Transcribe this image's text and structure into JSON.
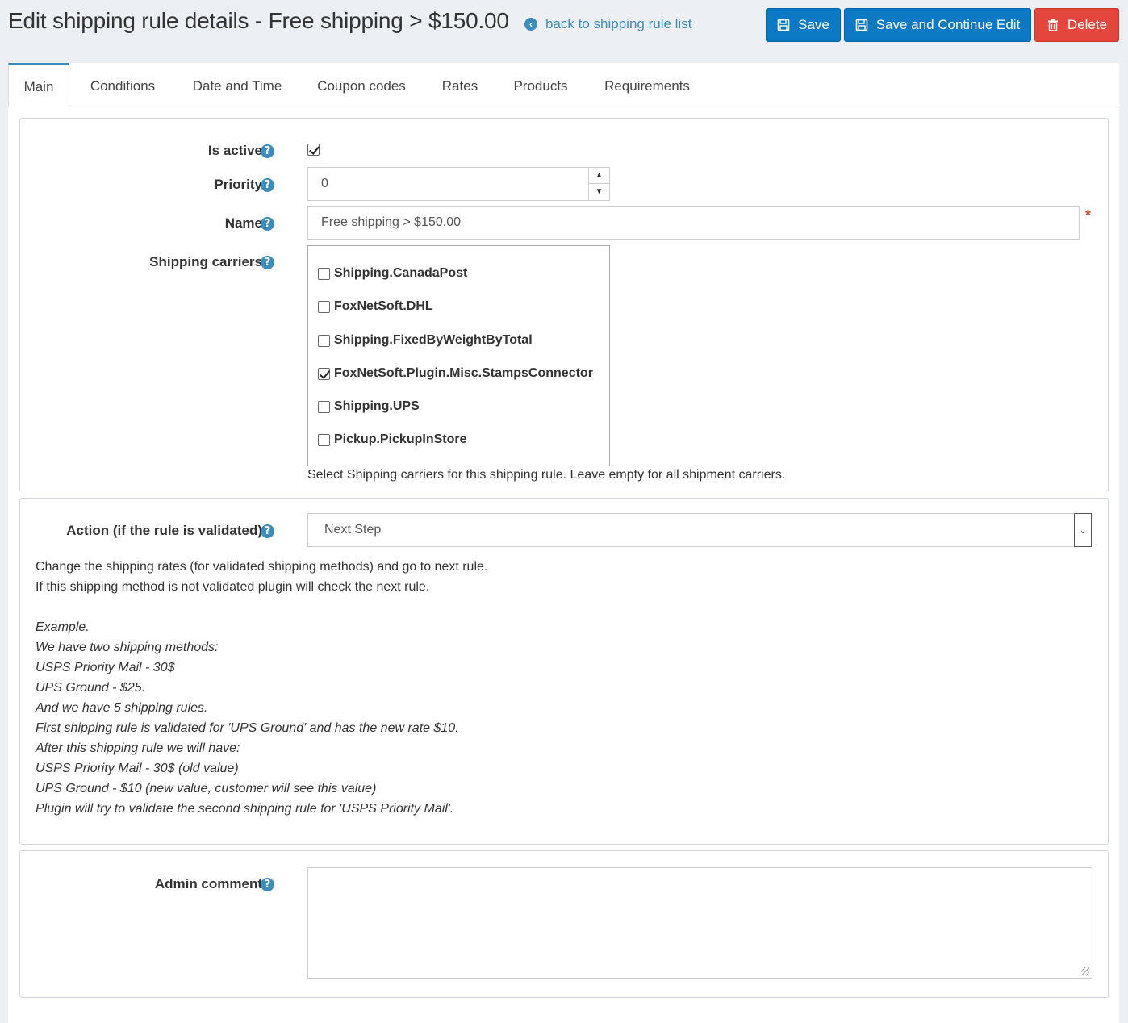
{
  "header": {
    "title": "Edit shipping rule details - Free shipping > $150.00",
    "back_link": "back to shipping rule list",
    "save_label": "Save",
    "save_continue_label": "Save and Continue Edit",
    "delete_label": "Delete"
  },
  "tabs": [
    {
      "label": "Main",
      "active": true
    },
    {
      "label": "Conditions",
      "active": false
    },
    {
      "label": "Date and Time",
      "active": false
    },
    {
      "label": "Coupon codes",
      "active": false
    },
    {
      "label": "Rates",
      "active": false
    },
    {
      "label": "Products",
      "active": false
    },
    {
      "label": "Requirements",
      "active": false
    }
  ],
  "main": {
    "is_active_label": "Is active",
    "is_active": true,
    "priority_label": "Priority",
    "priority_value": "0",
    "name_label": "Name",
    "name_value": "Free shipping > $150.00",
    "carriers_label": "Shipping carriers",
    "carriers": [
      {
        "label": "Shipping.CanadaPost",
        "checked": false
      },
      {
        "label": "FoxNetSoft.DHL",
        "checked": false
      },
      {
        "label": "Shipping.FixedByWeightByTotal",
        "checked": false
      },
      {
        "label": "FoxNetSoft.Plugin.Misc.StampsConnector",
        "checked": true
      },
      {
        "label": "Shipping.UPS",
        "checked": false
      },
      {
        "label": "Pickup.PickupInStore",
        "checked": false
      }
    ],
    "carriers_hint": "Select Shipping carriers for this shipping rule. Leave empty for all shipment carriers."
  },
  "action": {
    "label": "Action (if the rule is validated)",
    "selected": "Next Step",
    "description": [
      "Change the shipping rates (for validated shipping methods) and go to next rule.",
      "If this shipping method is not validated plugin will check the next rule."
    ],
    "example": [
      "Example.",
      "We have two shipping methods:",
      "USPS Priority Mail - 30$",
      "UPS Ground - $25.",
      "And we have 5 shipping rules.",
      "First shipping rule is validated for 'UPS Ground' and has the new rate $10.",
      "After this shipping rule we will have:",
      "USPS Priority Mail - 30$ (old value)",
      "UPS Ground - $10 (new value, customer will see this value)",
      "Plugin will try to validate the second shipping rule for 'USPS Priority Mail'."
    ]
  },
  "admin": {
    "comment_label": "Admin comment",
    "comment_value": ""
  },
  "icons": {
    "help": "question-circle-icon",
    "back": "arrow-circle-left-icon",
    "save": "floppy-disk-icon",
    "delete": "trash-icon"
  },
  "colors": {
    "primary": "#0b79c4",
    "danger": "#e3473b",
    "link": "#3c8dbc",
    "background": "#ecf0f5"
  }
}
